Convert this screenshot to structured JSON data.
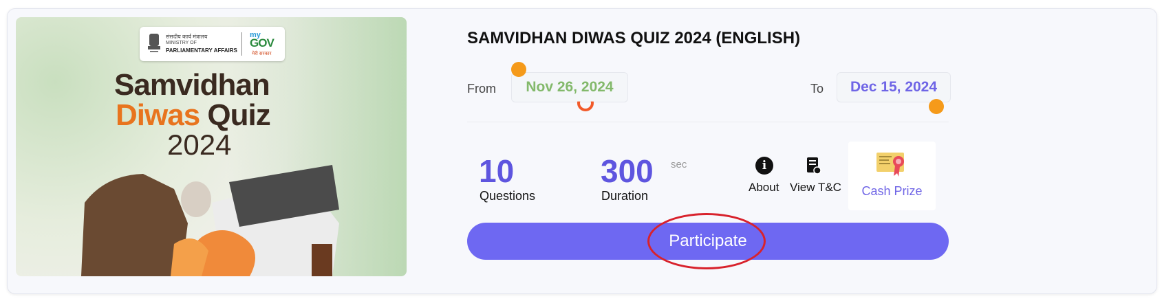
{
  "banner": {
    "ministry_hindi": "संसदीय कार्य मंत्रालय",
    "ministry_line1": "MINISTRY OF",
    "ministry_line2": "PARLIAMENTARY AFFAIRS",
    "mygov_my": "my",
    "mygov_gov": "GOV",
    "mygov_tagline": "मेरी सरकार",
    "title_line1": "Samvidhan",
    "title_line2_a": "Diwas",
    "title_line2_b": "Quiz",
    "title_line3": "2024"
  },
  "quiz": {
    "title": "SAMVIDHAN DIWAS QUIZ 2024 (ENGLISH)",
    "from_label": "From",
    "from_date": "Nov 26, 2024",
    "to_label": "To",
    "to_date": "Dec 15, 2024"
  },
  "stats": {
    "questions_value": "10",
    "questions_label": "Questions",
    "duration_value": "300",
    "duration_unit": "sec",
    "duration_label": "Duration"
  },
  "actions": {
    "about_label": "About",
    "tnc_label": "View T&C",
    "cash_label": "Cash Prize",
    "about_icon": "info-icon",
    "tnc_icon": "document-icon",
    "cash_icon": "certificate-icon"
  },
  "participate_label": "Participate",
  "colors": {
    "accent": "#6e68f2",
    "from_date": "#83b96b",
    "to_date": "#6f65e6",
    "annotation": "#d8222c"
  }
}
